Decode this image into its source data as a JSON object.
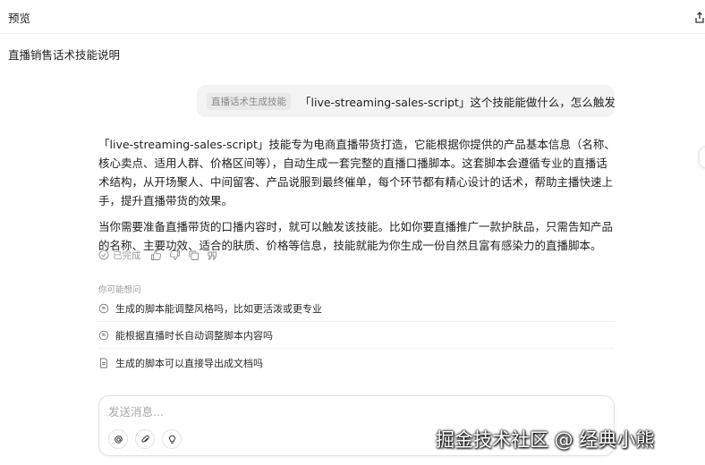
{
  "topbar": {
    "title": "预览"
  },
  "doc_title": "直播销售话术技能说明",
  "user_message": {
    "skill_tag": "直播话术生成技能",
    "text": "「live-streaming-sales-script」这个技能能做什么，怎么触发它?"
  },
  "answer": {
    "p1": "「live-streaming-sales-script」技能专为电商直播带货打造，它能根据你提供的产品基本信息（名称、核心卖点、适用人群、价格区间等），自动生成一套完整的直播口播脚本。这套脚本会遵循专业的直播话术结构，从开场聚人、中间留客、产品说服到最终催单，每个环节都有精心设计的话术，帮助主播快速上手，提升直播带货的效果。",
    "p2": "当你需要准备直播带货的口播内容时，就可以触发该技能。比如你要直播推广一款护肤品，只需告知产品的名称、主要功效、适合的肤质、价格等信息，技能就能为你生成一份自然且富有感染力的直播脚本。"
  },
  "actions": {
    "status": "已完成"
  },
  "suggestions": {
    "label": "你可能想问",
    "items": [
      {
        "text": "生成的脚本能调整风格吗，比如更活泼或更专业"
      },
      {
        "text": "能根据直播时长自动调整脚本内容吗"
      },
      {
        "text": "生成的脚本可以直接导出成文档吗"
      }
    ]
  },
  "composer": {
    "placeholder": "发送消息..."
  },
  "watermark": "掘金技术社区 @ 经典小熊"
}
